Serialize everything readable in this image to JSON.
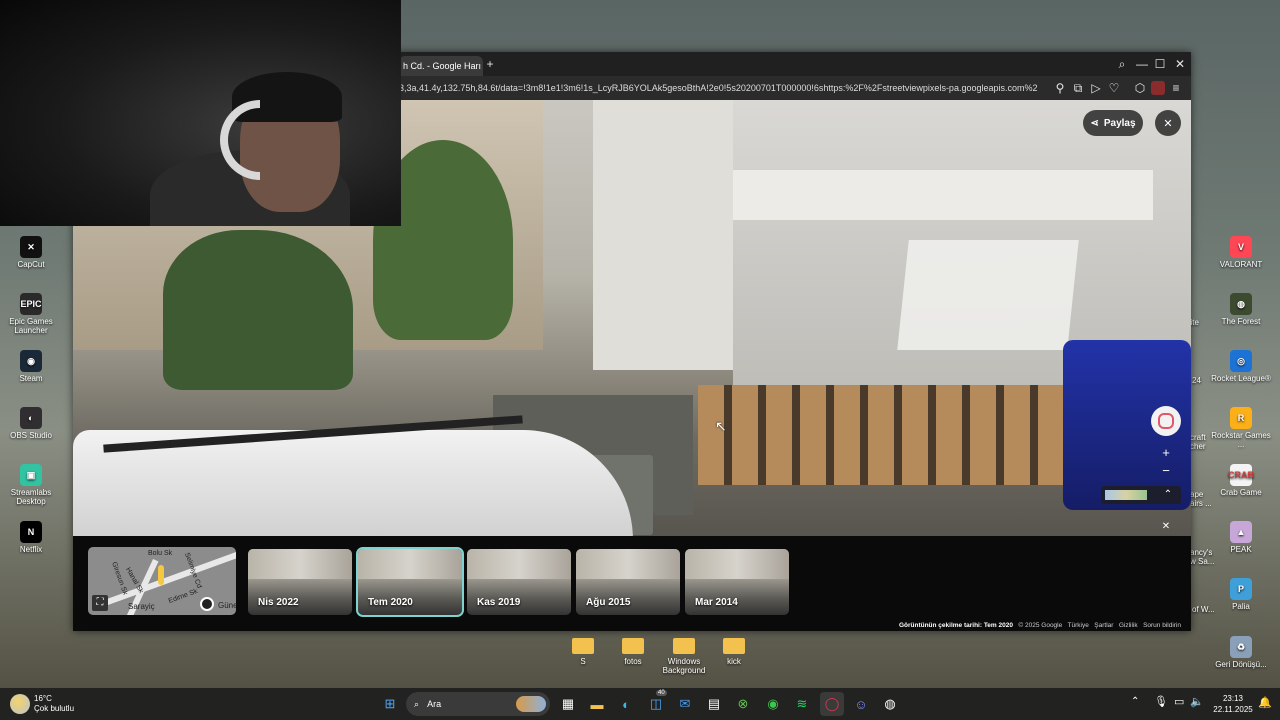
{
  "desktop": {
    "left_icons": [
      {
        "label": "CapCut",
        "glyph": "✕",
        "color": "#111111"
      },
      {
        "label": "Epic Games Launcher",
        "glyph": "EPIC",
        "color": "#2a2a2a"
      },
      {
        "label": "Steam",
        "glyph": "◉",
        "color": "#1b2838"
      },
      {
        "label": "OBS Studio",
        "glyph": "◐",
        "color": "#302e31"
      },
      {
        "label": "Streamlabs Desktop",
        "glyph": "▣",
        "color": "#31c3a2"
      },
      {
        "label": "Netflix",
        "glyph": "N",
        "color": "#000000"
      }
    ],
    "right_icons": [
      {
        "label": "VALORANT",
        "glyph": "V",
        "color": "#ff4655"
      },
      {
        "label": "The Forest",
        "glyph": "◍",
        "color": "#3c4a2f"
      },
      {
        "label": "Rocket League®",
        "glyph": "◎",
        "color": "#1d72d6"
      },
      {
        "label": "Rockstar Games ...",
        "glyph": "R",
        "color": "#fcaf17"
      },
      {
        "label": "Crab Game",
        "glyph": "CRAB",
        "color": "#f4f4f4"
      },
      {
        "label": "PEAK",
        "glyph": "▲",
        "color": "#c7a6d8"
      },
      {
        "label": "Palia",
        "glyph": "P",
        "color": "#3fa0d9"
      },
      {
        "label": "Geri Dönüşü...",
        "glyph": "♻",
        "color": "#8aa0b8"
      }
    ],
    "partial_right_labels": [
      "nite",
      "24",
      "craft cher",
      "ape airs ...",
      "ancy's w Sa...",
      "of W..."
    ],
    "folders": [
      "S",
      "fotos",
      "Windows Background",
      "kick"
    ]
  },
  "browser": {
    "tab_title": "h Cd. - Google Harı",
    "new_tab_label": "+",
    "url": "3,3a,41.4y,132.75h,84.6t/data=!3m8!1e1!3m6!1s_LcyRJB6YOLAk5gesoBthA!2e0!5s20200701T000000!6shttps:%2F%2Fstreetviewpixels-pa.googleapis.com%2",
    "window_controls": [
      "⌕",
      "—",
      "☐",
      "✕"
    ],
    "toolbar_icons": [
      "⚲",
      "⧉",
      "▷",
      "♡",
      "⬡",
      "▣",
      "≡"
    ]
  },
  "streetview": {
    "share_label": "Paylaş",
    "close_label": "✕",
    "zoom_in": "+",
    "zoom_out": "−",
    "expand": "⌃",
    "close2": "✕",
    "cursor": "↖"
  },
  "filmstrip": {
    "map_streets": [
      "Bolu Sk",
      "Giresun Sk",
      "Hanal Sk",
      "Edirne Sk",
      "Selimiye Cd",
      "Sarayiç",
      "Güne"
    ],
    "thumbs": [
      {
        "label": "Nis 2022",
        "selected": false
      },
      {
        "label": "Tem 2020",
        "selected": true
      },
      {
        "label": "Kas 2019",
        "selected": false
      },
      {
        "label": "Ağu 2015",
        "selected": false
      },
      {
        "label": "Mar 2014",
        "selected": false
      }
    ],
    "footer_date": "Görüntünün çekilme tarihi: Tem 2020",
    "footer_links": [
      "© 2025 Google",
      "Türkiye",
      "Şartlar",
      "Gizlilik",
      "Sorun bildirin"
    ]
  },
  "taskbar": {
    "weather_temp": "16°C",
    "weather_text": "Çok bulutlu",
    "search_label": "Ara",
    "badge_count": "40",
    "time": "23:13",
    "date": "22.11.2025"
  }
}
